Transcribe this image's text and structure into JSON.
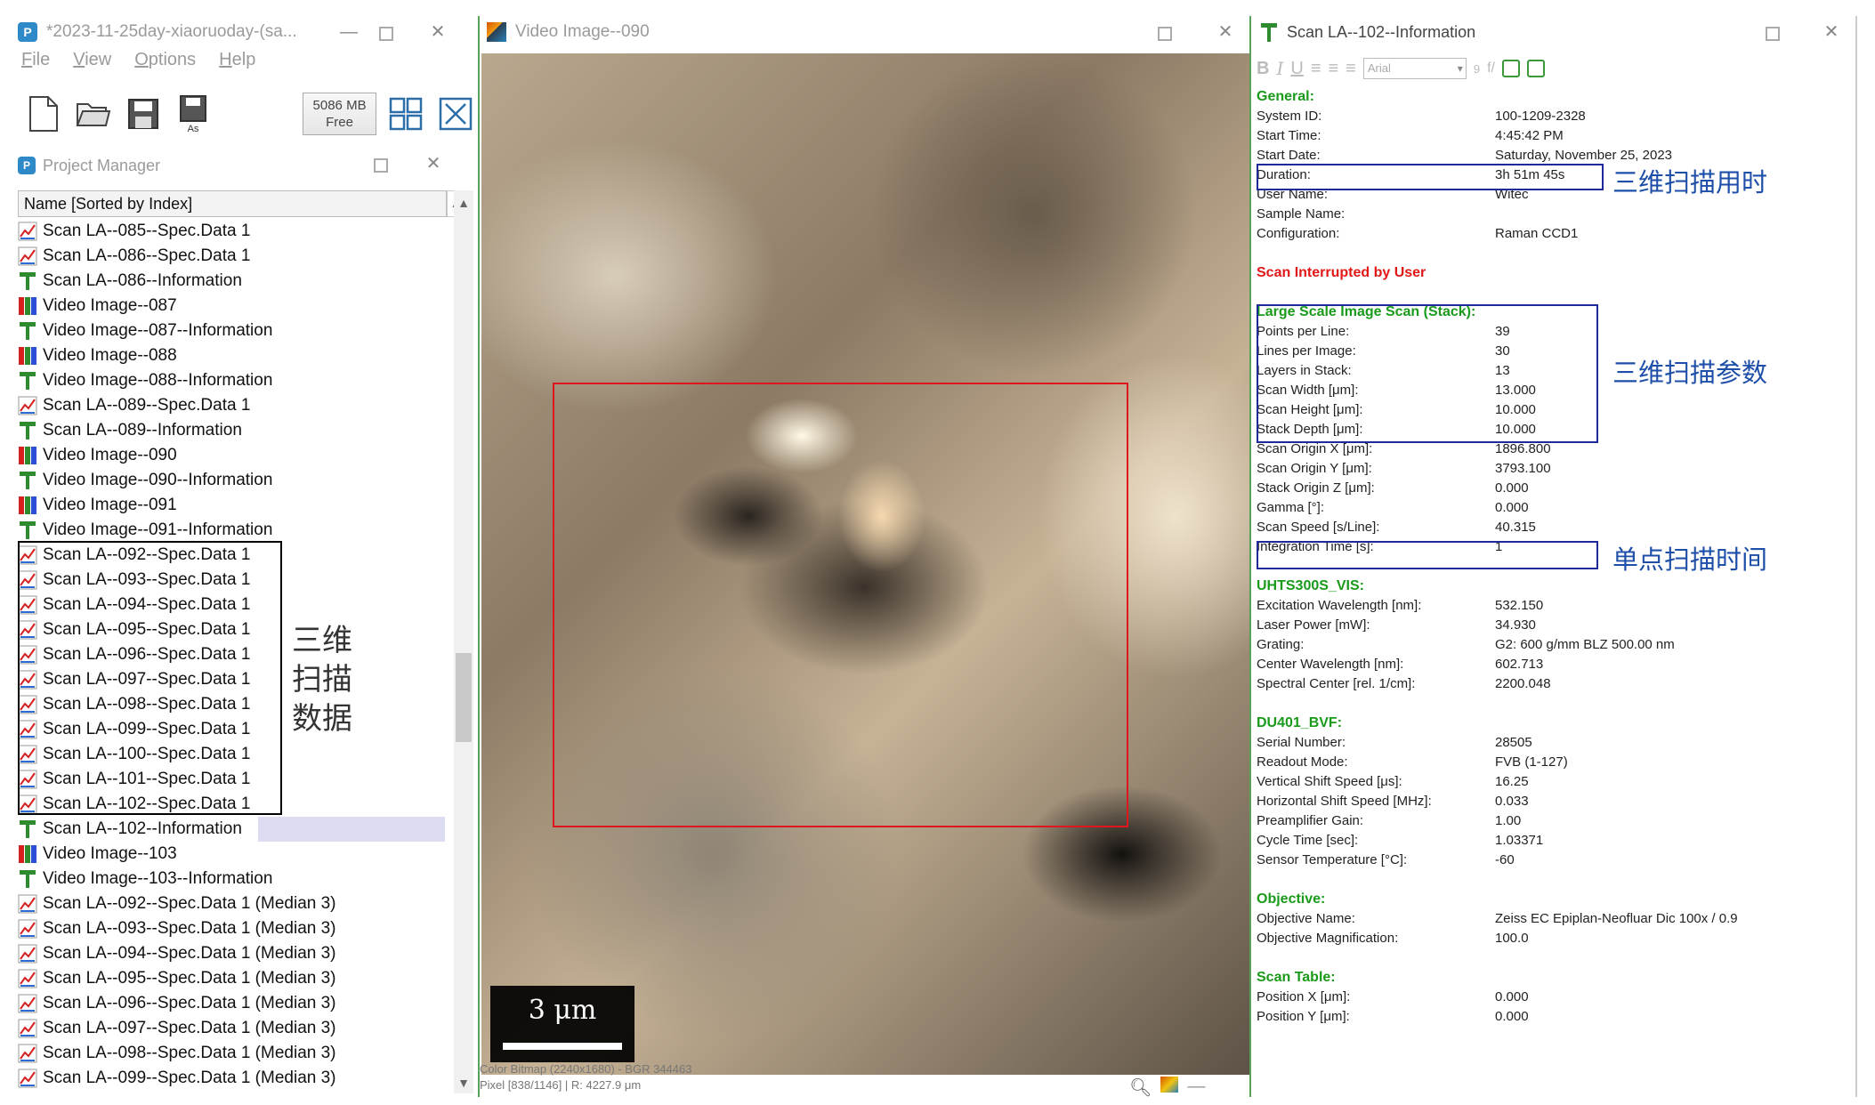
{
  "left": {
    "window_title": "*2023-11-25day-xiaoruoday-(sa...",
    "menu": [
      "File",
      "View",
      "Options",
      "Help"
    ],
    "memory": {
      "value": "5086 MB",
      "label": "Free"
    },
    "panel_title": "Project Manager",
    "list_header": "Name [Sorted by Index]",
    "items": [
      {
        "type": "spec",
        "label": "Scan LA--085--Spec.Data 1"
      },
      {
        "type": "spec",
        "label": "Scan LA--086--Spec.Data 1"
      },
      {
        "type": "info",
        "label": "Scan LA--086--Information"
      },
      {
        "type": "video",
        "label": "Video Image--087"
      },
      {
        "type": "info",
        "label": "Video Image--087--Information"
      },
      {
        "type": "video",
        "label": "Video Image--088"
      },
      {
        "type": "info",
        "label": "Video Image--088--Information"
      },
      {
        "type": "spec",
        "label": "Scan LA--089--Spec.Data 1"
      },
      {
        "type": "info",
        "label": "Scan LA--089--Information"
      },
      {
        "type": "video",
        "label": "Video Image--090"
      },
      {
        "type": "info",
        "label": "Video Image--090--Information"
      },
      {
        "type": "video",
        "label": "Video Image--091"
      },
      {
        "type": "info",
        "label": "Video Image--091--Information"
      },
      {
        "type": "spec",
        "label": "Scan LA--092--Spec.Data 1"
      },
      {
        "type": "spec",
        "label": "Scan LA--093--Spec.Data 1"
      },
      {
        "type": "spec",
        "label": "Scan LA--094--Spec.Data 1"
      },
      {
        "type": "spec",
        "label": "Scan LA--095--Spec.Data 1"
      },
      {
        "type": "spec",
        "label": "Scan LA--096--Spec.Data 1"
      },
      {
        "type": "spec",
        "label": "Scan LA--097--Spec.Data 1"
      },
      {
        "type": "spec",
        "label": "Scan LA--098--Spec.Data 1"
      },
      {
        "type": "spec",
        "label": "Scan LA--099--Spec.Data 1"
      },
      {
        "type": "spec",
        "label": "Scan LA--100--Spec.Data 1"
      },
      {
        "type": "spec",
        "label": "Scan LA--101--Spec.Data 1"
      },
      {
        "type": "spec",
        "label": "Scan LA--102--Spec.Data 1"
      },
      {
        "type": "info",
        "label": "Scan LA--102--Information",
        "selected": true
      },
      {
        "type": "video",
        "label": "Video Image--103"
      },
      {
        "type": "info",
        "label": "Video Image--103--Information"
      },
      {
        "type": "spec",
        "label": "Scan LA--092--Spec.Data 1 (Median 3)"
      },
      {
        "type": "spec",
        "label": "Scan LA--093--Spec.Data 1 (Median 3)"
      },
      {
        "type": "spec",
        "label": "Scan LA--094--Spec.Data 1 (Median 3)"
      },
      {
        "type": "spec",
        "label": "Scan LA--095--Spec.Data 1 (Median 3)"
      },
      {
        "type": "spec",
        "label": "Scan LA--096--Spec.Data 1 (Median 3)"
      },
      {
        "type": "spec",
        "label": "Scan LA--097--Spec.Data 1 (Median 3)"
      },
      {
        "type": "spec",
        "label": "Scan LA--098--Spec.Data 1 (Median 3)"
      },
      {
        "type": "spec",
        "label": "Scan LA--099--Spec.Data 1 (Median 3)"
      }
    ],
    "annotation": [
      "三维",
      "扫描",
      "数据"
    ]
  },
  "middle": {
    "window_title": "Video Image--090",
    "scale_label": "3 μm",
    "status_line_1": "Color Bitmap (2240x1680) - BGR 344463",
    "status_line_2": "Pixel [838/1146] | R: 4227.9 μm"
  },
  "right": {
    "window_title": "Scan LA--102--Information",
    "font_name": "Arial",
    "font_size": "9",
    "sections": [
      {
        "title": "General:",
        "rows": [
          {
            "k": "System ID:",
            "v": "100-1209-2328"
          },
          {
            "k": "Start Time:",
            "v": "4:45:42 PM"
          },
          {
            "k": "Start Date:",
            "v": "Saturday, November 25, 2023"
          },
          {
            "k": "Duration:",
            "v": "3h 51m 45s"
          },
          {
            "k": "User Name:",
            "v": "Witec"
          },
          {
            "k": "Sample Name:",
            "v": ""
          },
          {
            "k": "Configuration:",
            "v": "Raman CCD1"
          }
        ]
      },
      {
        "warning": "Scan Interrupted by User"
      },
      {
        "title": "Large Scale Image Scan (Stack):",
        "rows": [
          {
            "k": "Points per Line:",
            "v": "39"
          },
          {
            "k": "Lines per Image:",
            "v": "30"
          },
          {
            "k": "Layers in Stack:",
            "v": "13"
          },
          {
            "k": "Scan Width [μm]:",
            "v": "13.000"
          },
          {
            "k": "Scan Height [μm]:",
            "v": "10.000"
          },
          {
            "k": "Stack Depth [μm]:",
            "v": "10.000"
          },
          {
            "k": "Scan Origin X [μm]:",
            "v": "1896.800"
          },
          {
            "k": "Scan Origin Y [μm]:",
            "v": "3793.100"
          },
          {
            "k": "Stack Origin Z [μm]:",
            "v": "0.000"
          },
          {
            "k": "Gamma [°]:",
            "v": "0.000"
          },
          {
            "k": "Scan Speed [s/Line]:",
            "v": "40.315"
          },
          {
            "k": "Integration Time [s]:",
            "v": "1"
          }
        ]
      },
      {
        "title": "UHTS300S_VIS:",
        "rows": [
          {
            "k": "Excitation Wavelength [nm]:",
            "v": "532.150"
          },
          {
            "k": "Laser Power [mW]:",
            "v": "34.930"
          },
          {
            "k": "Grating:",
            "v": "G2: 600 g/mm BLZ 500.00 nm"
          },
          {
            "k": "Center Wavelength [nm]:",
            "v": "602.713"
          },
          {
            "k": "Spectral Center [rel. 1/cm]:",
            "v": "2200.048"
          }
        ]
      },
      {
        "title": "DU401_BVF:",
        "rows": [
          {
            "k": "Serial Number:",
            "v": "28505"
          },
          {
            "k": "Readout Mode:",
            "v": "FVB (1-127)"
          },
          {
            "k": "Vertical Shift Speed [μs]:",
            "v": "16.25"
          },
          {
            "k": "Horizontal Shift Speed [MHz]:",
            "v": "0.033"
          },
          {
            "k": "Preamplifier Gain:",
            "v": "1.00"
          },
          {
            "k": "Cycle Time [sec]:",
            "v": "1.03371"
          },
          {
            "k": "Sensor Temperature [°C]:",
            "v": "-60"
          }
        ]
      },
      {
        "title": "Objective:",
        "rows": [
          {
            "k": "Objective Name:",
            "v": "Zeiss EC Epiplan-Neofluar Dic 100x / 0.9"
          },
          {
            "k": "Objective Magnification:",
            "v": "100.0"
          }
        ]
      },
      {
        "title": "Scan Table:",
        "rows": [
          {
            "k": "Position X [μm]:",
            "v": "0.000"
          },
          {
            "k": "Position Y [μm]:",
            "v": "0.000"
          }
        ]
      }
    ],
    "annotations": {
      "duration": "三维扫描用时",
      "params": "三维扫描参数",
      "integration": "单点扫描时间"
    }
  },
  "colors": {
    "section_green": "#1a9a1a",
    "warning_red": "#e01818",
    "annotation_blue": "#1e4fa8",
    "roi_red": "#e0161e"
  }
}
